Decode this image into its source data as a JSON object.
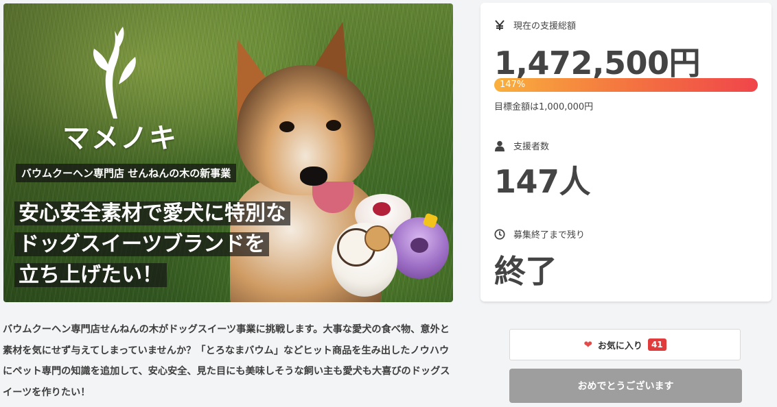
{
  "hero": {
    "logo_text": "マメノキ",
    "subtitle": "バウムクーヘン専門店 せんねんの木の新事業",
    "headline_lines": [
      "安心安全素材で愛犬に特別な",
      "ドッグスイーツブランドを",
      "立ち上げたい！"
    ]
  },
  "description": "バウムクーヘン専門店せんねんの木がドッグスイーツ事業に挑戦します。大事な愛犬の食べ物、意外と素材を気にせず与えてしまっていませんか？「とろなまバウム」などヒット商品を生み出したノウハウにペット専門の知識を追加して、安心安全、見た目にも美味しそうな飼い主も愛犬も大喜びのドッグスイーツを作りたい！",
  "stats": {
    "amount_label": "現在の支援総額",
    "amount_icon": "yen-icon",
    "amount_value": "1,472,500円",
    "progress_percent": 147,
    "progress_text": "147%",
    "goal_text": "目標金額は1,000,000円",
    "supporters_label": "支援者数",
    "supporters_icon": "user-icon",
    "supporters_value": "147人",
    "remaining_label": "募集終了まで残り",
    "remaining_icon": "clock-icon",
    "remaining_value": "終了"
  },
  "actions": {
    "favorite_label": "お気に入り",
    "favorite_count": "41",
    "favorite_icon": "heart-icon",
    "finished_label": "おめでとうございます"
  },
  "colors": {
    "progress_start": "#f9b03d",
    "progress_end": "#f0454a",
    "badge": "#e03c3c",
    "finished_button": "#9e9e9e"
  }
}
